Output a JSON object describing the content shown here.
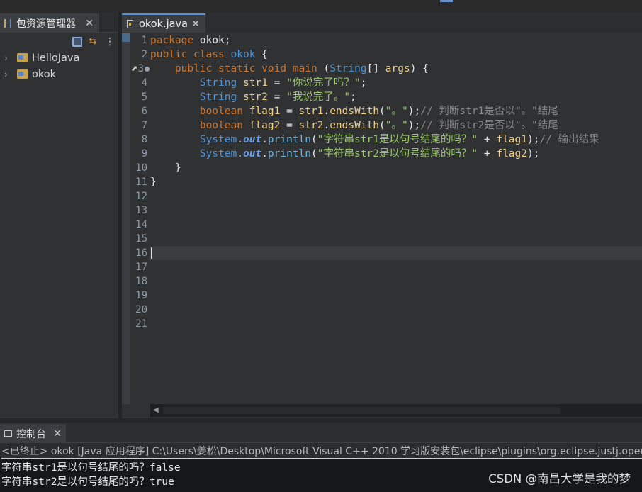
{
  "package_explorer": {
    "title": "包资源管理器",
    "close": "✕",
    "menu_icon": "⋮",
    "link_icon": "⇆",
    "projects": [
      {
        "name": "HelloJava"
      },
      {
        "name": "okok"
      }
    ]
  },
  "editor": {
    "tab_title": "okok.java",
    "close": "✕",
    "line_numbers": [
      "1",
      "2",
      "3",
      "4",
      "5",
      "6",
      "7",
      "8",
      "9",
      "10",
      "11",
      "12",
      "13",
      "14",
      "15",
      "16",
      "17",
      "18",
      "19",
      "20",
      "21"
    ],
    "code": {
      "l1_kw": "package",
      "l1_rest": " okok;",
      "l2_kw1": "public",
      "l2_kw2": " class",
      "l2_name": " okok",
      "l2_rest": " {",
      "l3_indent": "    ",
      "l3_kw1": "public",
      "l3_kw2": " static",
      "l3_kw3": " void",
      "l3_name": " main",
      "l3_open": " (",
      "l3_type": "String",
      "l3_arr": "[] ",
      "l3_param": "args",
      "l3_close": ") {",
      "l4_indent": "        ",
      "l4_type": "String",
      "l4_var": " str1",
      "l4_eq": " = ",
      "l4_str": "\"你说完了吗？\"",
      "l4_end": ";",
      "l5_indent": "        ",
      "l5_type": "String",
      "l5_var": " str2",
      "l5_eq": " = ",
      "l5_str": "\"我说完了。\"",
      "l5_end": ";",
      "l6_indent": "        ",
      "l6_kw": "boolean",
      "l6_var": " flag1",
      "l6_eq": " = ",
      "l6_obj": "str1",
      "l6_dot": ".",
      "l6_mtd": "endsWith",
      "l6_p1": "(",
      "l6_str": "\"。\"",
      "l6_p2": ");",
      "l6_cm": "// 判断str1是否以\"。\"结尾",
      "l7_indent": "        ",
      "l7_kw": "boolean",
      "l7_var": " flag2",
      "l7_eq": " = ",
      "l7_obj": "str2",
      "l7_dot": ".",
      "l7_mtd": "endsWith",
      "l7_p1": "(",
      "l7_str": "\"。\"",
      "l7_p2": ");",
      "l7_cm": "// 判断str2是否以\"。\"结尾",
      "l8_indent": "        ",
      "l8_sys": "System",
      "l8_dot1": ".",
      "l8_out": "out",
      "l8_dot2": ".",
      "l8_mtd": "println",
      "l8_p1": "(",
      "l8_str": "\"字符串str1是以句号结尾的吗？\"",
      "l8_plus": " + ",
      "l8_var": "flag1",
      "l8_p2": ");",
      "l8_cm": "// 输出结果",
      "l9_indent": "        ",
      "l9_sys": "System",
      "l9_dot1": ".",
      "l9_out": "out",
      "l9_dot2": ".",
      "l9_mtd": "println",
      "l9_p1": "(",
      "l9_str": "\"字符串str2是以句号结尾的吗？\"",
      "l9_plus": " + ",
      "l9_var": "flag2",
      "l9_p2": ");",
      "l10": "    }",
      "l11": "}"
    }
  },
  "console": {
    "title": "控制台",
    "close": "✕",
    "status": "<已终止> okok [Java 应用程序] C:\\Users\\姜松\\Desktop\\Microsoft Visual C++ 2010 学习版安装包\\eclipse\\plugins\\org.eclipse.justj.openjdk",
    "output": [
      "字符串str1是以句号结尾的吗？false",
      "字符串str2是以句号结尾的吗？true"
    ]
  },
  "watermark": "CSDN @南昌大学是我的梦"
}
